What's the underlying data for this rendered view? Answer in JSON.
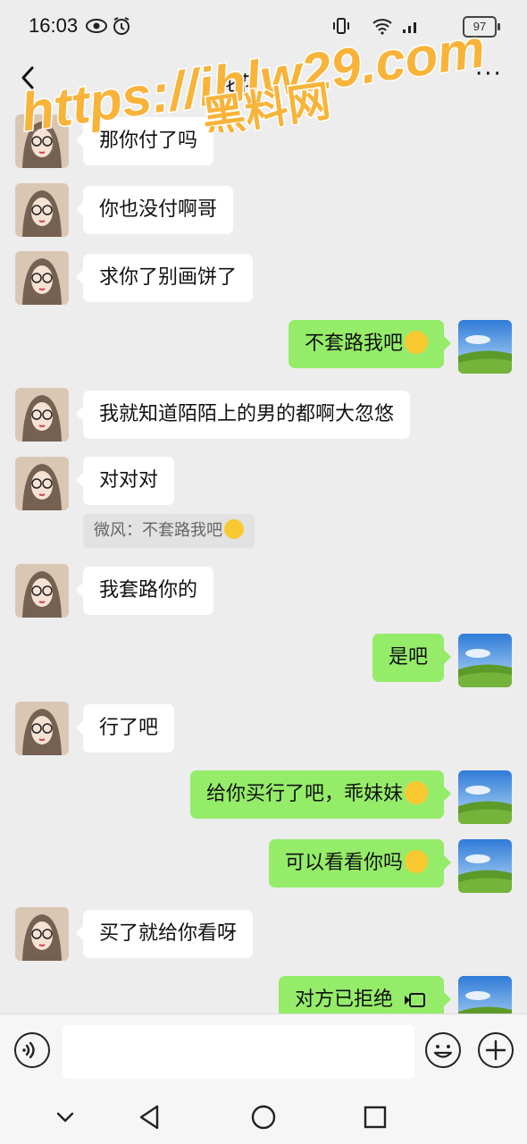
{
  "status_bar": {
    "time": "16:03",
    "battery": "97"
  },
  "header": {
    "back_icon": "chevron-left-icon",
    "contact_name": "花花",
    "more": "···"
  },
  "watermark": {
    "line1": "https://ihlw29.com",
    "line2": "黑料网",
    "color": "#f8b43a"
  },
  "messages": [
    {
      "side": "left",
      "text": "那你付了吗"
    },
    {
      "side": "left",
      "text": "你也没付啊哥"
    },
    {
      "side": "left",
      "text": "求你了别画饼了"
    },
    {
      "side": "right",
      "text": "不套路我吧",
      "emoji": "smirk-emoji"
    },
    {
      "side": "left",
      "text": "我就知道陌陌上的男的都啊大忽悠"
    },
    {
      "side": "left",
      "text": "对对对",
      "quote": "微风：不套路我吧"
    },
    {
      "side": "left",
      "text": "我套路你的"
    },
    {
      "side": "right",
      "text": "是吧"
    },
    {
      "side": "left",
      "text": "行了吧"
    },
    {
      "side": "right",
      "text": "给你买行了吧，乖妹妹",
      "emoji": "crying-emoji"
    },
    {
      "side": "right",
      "text": "可以看看你吗",
      "emoji": "laughing-tears-emoji"
    },
    {
      "side": "left",
      "text": "买了就给你看呀"
    },
    {
      "side": "right",
      "text": "对方已拒绝",
      "emoji": "video-call-icon"
    }
  ],
  "colors": {
    "sent_bubble": "#95ec69",
    "received_bubble": "#ffffff",
    "background": "#ededed"
  },
  "input_bar": {
    "voice_icon": "voice-icon",
    "emoji_icon": "emoji-icon",
    "plus_icon": "plus-icon"
  },
  "nav_bar": {
    "icons": [
      "chevron-down-icon",
      "back-triangle-icon",
      "home-circle-icon",
      "recents-square-icon"
    ]
  }
}
